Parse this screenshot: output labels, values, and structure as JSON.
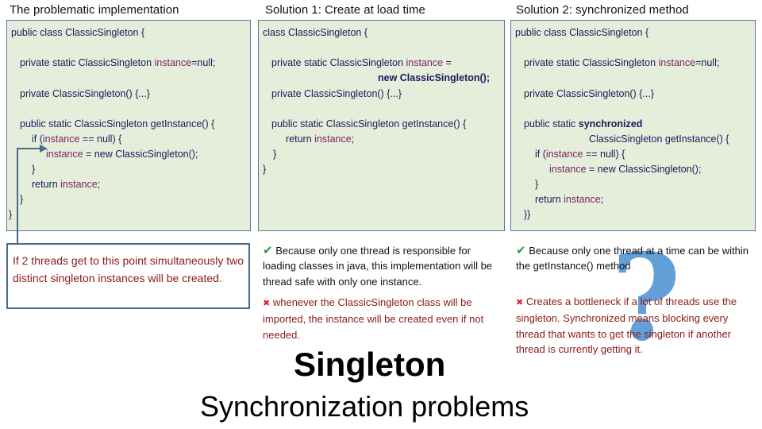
{
  "columns": [
    {
      "heading": "The problematic implementation",
      "code": {
        "l1": "public class ClassicSingleton {",
        "l2a": "private static ClassicSingleton ",
        "l2b": "instance",
        "l2c": "=null;",
        "l3": "private ClassicSingleton() {...}",
        "l4": "public static ClassicSingleton getInstance() {",
        "l5a": "if (",
        "l5b": "instance",
        "l5c": " == null) {",
        "l6a": "instance",
        "l6b": " = new ClassicSingleton();",
        "l7": "}",
        "l8a": "return ",
        "l8b": "instance",
        "l8c": ";",
        "l9": "}",
        "l10": "}"
      },
      "note": "If 2 threads get to this point simultaneously two distinct singleton instances will be created."
    },
    {
      "heading": "Solution 1: Create at load time",
      "code": {
        "l1": "class ClassicSingleton {",
        "l2a": "private static ClassicSingleton ",
        "l2b": "instance",
        "l2c": " =",
        "l2d": "new ClassicSingleton();",
        "l3": "private ClassicSingleton() {...}",
        "l4": "public static ClassicSingleton getInstance() {",
        "l5a": "return ",
        "l5b": "instance",
        "l5c": ";",
        "l6": "}",
        "l7": "}"
      },
      "pro": "Because only one thread is responsible for loading classes in java, this implementation will be thread safe with only one instance.",
      "con": "whenever the ClassicSingleton class will be imported, the instance will be created even if not needed."
    },
    {
      "heading": "Solution 2: synchronized method",
      "code": {
        "l1": "public class ClassicSingleton {",
        "l2a": "private static ClassicSingleton ",
        "l2b": "instance",
        "l2c": "=null;",
        "l3": "private ClassicSingleton() {...}",
        "l4a": "public static ",
        "l4b": "synchronized",
        "l4c": "ClassicSingleton getInstance() {",
        "l5a": "if (",
        "l5b": "instance",
        "l5c": " == null) {",
        "l6a": "instance",
        "l6b": " = new ClassicSingleton();",
        "l7": "}",
        "l8a": "return ",
        "l8b": "instance",
        "l8c": ";",
        "l9": "}}"
      },
      "pro": "Because only one thread at a time can be within the getInstance() method",
      "con": "Creates a bottleneck if a lot of threads use the singleton. Synchronized means blocking every thread that wants to get the singleton if another thread is currently getting it."
    }
  ],
  "icons": {
    "check": "✔",
    "cross": "✖",
    "question": "?"
  },
  "title": "Singleton",
  "subtitle": "Synchronization problems",
  "colors": {
    "box_bg": "#e4eedb",
    "box_border": "#5b7794",
    "code_text": "#1b1b5a",
    "variable": "#7b2560",
    "warning_text": "#8b1a1a",
    "check": "#2e9a4a",
    "cross": "#d6232e",
    "question_mark": "#5b9bd5"
  }
}
